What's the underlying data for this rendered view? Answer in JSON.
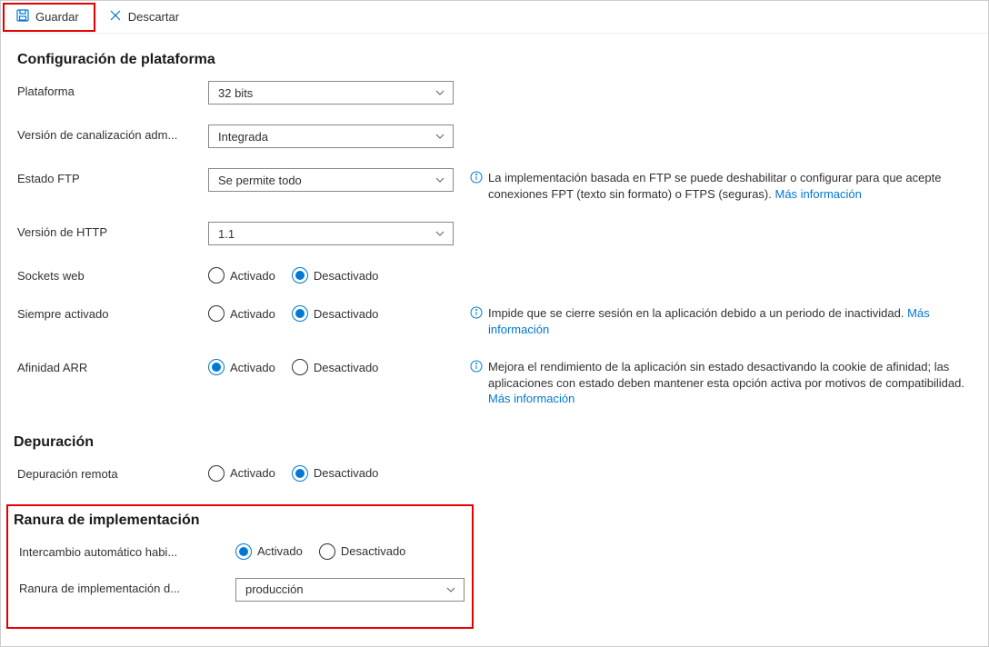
{
  "toolbar": {
    "save_label": "Guardar",
    "discard_label": "Descartar"
  },
  "platform_section": {
    "title": "Configuración de plataforma",
    "platform": {
      "label": "Plataforma",
      "value": "32 bits"
    },
    "pipeline": {
      "label": "Versión de canalización adm...",
      "value": "Integrada"
    },
    "ftp": {
      "label": "Estado FTP",
      "value": "Se permite todo",
      "hint": "La implementación basada en FTP se puede deshabilitar o configurar para que acepte conexiones FPT (texto sin formato) o FTPS (seguras). ",
      "more": "Más información"
    },
    "http": {
      "label": "Versión de HTTP",
      "value": "1.1"
    },
    "websockets": {
      "label": "Sockets web",
      "on": "Activado",
      "off": "Desactivado",
      "value": "off"
    },
    "always_on": {
      "label": "Siempre activado",
      "on": "Activado",
      "off": "Desactivado",
      "value": "off",
      "hint": "Impide que se cierre sesión en la aplicación debido a un periodo de inactividad. ",
      "more": "Más información"
    },
    "arr": {
      "label": "Afinidad ARR",
      "on": "Activado",
      "off": "Desactivado",
      "value": "on",
      "hint": "Mejora el rendimiento de la aplicación sin estado desactivando la cookie de afinidad; las aplicaciones con estado deben mantener esta opción activa por motivos de compatibilidad. ",
      "more": "Más información"
    }
  },
  "debug_section": {
    "title": "Depuración",
    "remote": {
      "label": "Depuración remota",
      "on": "Activado",
      "off": "Desactivado",
      "value": "off"
    }
  },
  "slot_section": {
    "title": "Ranura de implementación",
    "autoswap": {
      "label": "Intercambio automático habi...",
      "on": "Activado",
      "off": "Desactivado",
      "value": "on"
    },
    "target": {
      "label": "Ranura de implementación d...",
      "value": "producción"
    }
  }
}
